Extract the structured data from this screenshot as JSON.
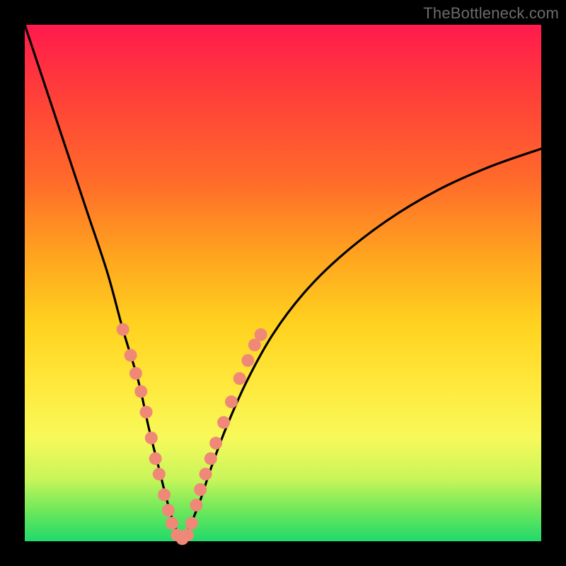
{
  "watermark": "TheBottleneck.com",
  "chart_data": {
    "type": "line",
    "title": "",
    "xlabel": "",
    "ylabel": "",
    "xlim": [
      0,
      100
    ],
    "ylim": [
      0,
      100
    ],
    "background_gradient": {
      "orientation": "vertical",
      "stops": [
        {
          "pos": 0,
          "color": "#ff1a4d"
        },
        {
          "pos": 30,
          "color": "#ff6a2a"
        },
        {
          "pos": 58,
          "color": "#ffd21f"
        },
        {
          "pos": 80,
          "color": "#f7f95a"
        },
        {
          "pos": 100,
          "color": "#21d96b"
        }
      ]
    },
    "series": [
      {
        "name": "bottleneck-curve",
        "color": "#000000",
        "x": [
          0,
          4,
          8,
          12,
          16,
          19,
          22,
          24,
          26,
          27.5,
          29,
          30.5,
          32,
          34,
          36,
          39,
          43,
          48,
          54,
          61,
          70,
          80,
          90,
          100
        ],
        "y": [
          100,
          88,
          76,
          64,
          52,
          41,
          31,
          22,
          14,
          8,
          3,
          0.5,
          3,
          8,
          14,
          22,
          31,
          40,
          48,
          55,
          62,
          68,
          72.5,
          76
        ]
      }
    ],
    "markers": {
      "name": "highlighted-points",
      "color": "#f08878",
      "radius_px": 9,
      "points": [
        {
          "x": 19.0,
          "y": 41
        },
        {
          "x": 20.5,
          "y": 36
        },
        {
          "x": 21.5,
          "y": 32.5
        },
        {
          "x": 22.5,
          "y": 29
        },
        {
          "x": 23.5,
          "y": 25
        },
        {
          "x": 24.5,
          "y": 20
        },
        {
          "x": 25.3,
          "y": 16
        },
        {
          "x": 26.0,
          "y": 13
        },
        {
          "x": 27.0,
          "y": 9
        },
        {
          "x": 27.8,
          "y": 6
        },
        {
          "x": 28.5,
          "y": 3.5
        },
        {
          "x": 29.5,
          "y": 1.2
        },
        {
          "x": 30.5,
          "y": 0.5
        },
        {
          "x": 31.5,
          "y": 1.2
        },
        {
          "x": 32.3,
          "y": 3.5
        },
        {
          "x": 33.2,
          "y": 7
        },
        {
          "x": 34.0,
          "y": 10
        },
        {
          "x": 35.0,
          "y": 13
        },
        {
          "x": 36.0,
          "y": 16
        },
        {
          "x": 37.0,
          "y": 19
        },
        {
          "x": 38.5,
          "y": 23
        },
        {
          "x": 40.0,
          "y": 27
        },
        {
          "x": 41.6,
          "y": 31.5
        },
        {
          "x": 43.2,
          "y": 35
        },
        {
          "x": 44.5,
          "y": 38
        },
        {
          "x": 45.7,
          "y": 40
        }
      ]
    }
  }
}
